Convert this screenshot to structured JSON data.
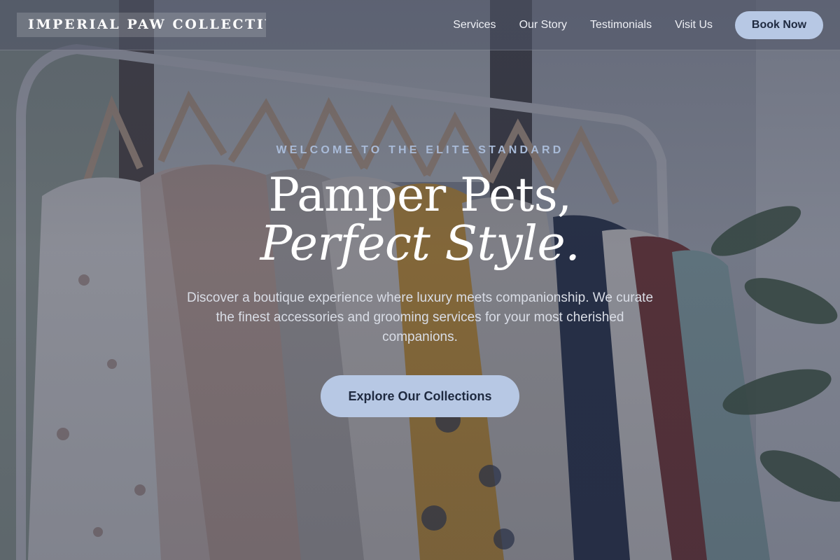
{
  "header": {
    "brand": "IMPERIAL PAW COLLECTIVE",
    "nav": [
      {
        "label": "Services"
      },
      {
        "label": "Our Story"
      },
      {
        "label": "Testimonials"
      },
      {
        "label": "Visit Us"
      }
    ],
    "cta_label": "Book Now"
  },
  "hero": {
    "eyebrow": "WELCOME TO THE ELITE STANDARD",
    "title_line1": "Pamper Pets,",
    "title_line2": "Perfect Style.",
    "description": "Discover a boutique experience where luxury meets companionship. We curate the finest accessories and grooming services for your most cherished companions.",
    "button_label": "Explore Our Collections",
    "background_image": "clothing-rack-photo"
  },
  "colors": {
    "accent": "#b7c8e4",
    "accent_text": "#1f2a40",
    "eyebrow": "#a9bbd8",
    "overlay": "#343a4e"
  }
}
